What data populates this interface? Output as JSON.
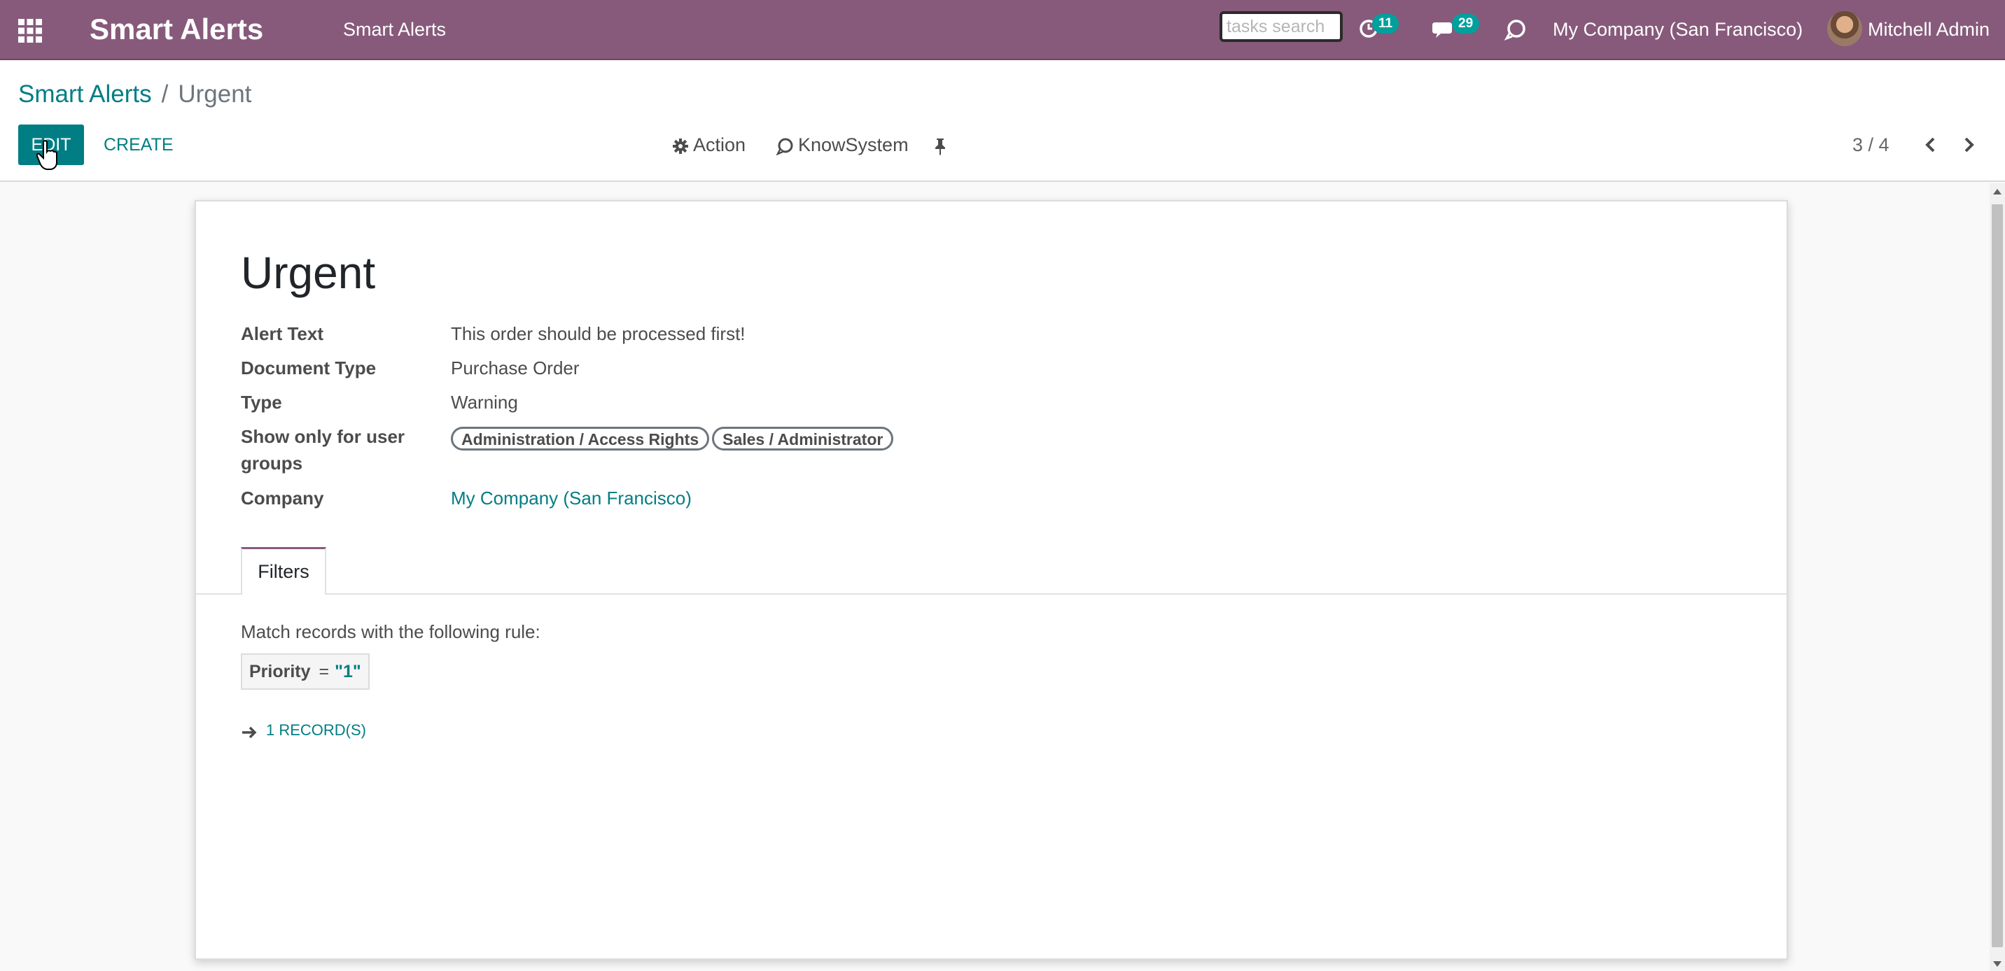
{
  "navbar": {
    "app_name": "Smart Alerts",
    "menu_item": "Smart Alerts",
    "search_placeholder": "tasks search",
    "activity_count": "11",
    "messages_count": "29",
    "company": "My Company (San Francisco)",
    "user_name": "Mitchell Admin",
    "icons": [
      "apps-grid-icon",
      "clock-icon",
      "chat-icon",
      "knowsystem-icon"
    ]
  },
  "control_panel": {
    "breadcrumb": [
      {
        "label": "Smart Alerts"
      },
      {
        "label": "Urgent"
      }
    ],
    "separator": "/",
    "edit_label": "EDIT",
    "create_label": "CREATE",
    "action_label": "Action",
    "knowsystem_label": "KnowSystem",
    "pager_value": "3 / 4"
  },
  "form": {
    "title": "Urgent",
    "fields": [
      {
        "label": "Alert Text",
        "value": "This order should be processed first!"
      },
      {
        "label": "Document Type",
        "value": "Purchase Order"
      },
      {
        "label": "Type",
        "value": "Warning"
      },
      {
        "label": "Show only for user groups",
        "tags": [
          "Administration / Access Rights",
          "Sales / Administrator"
        ]
      },
      {
        "label": "Company",
        "value": "My Company (San Francisco)"
      }
    ],
    "tabs": [
      {
        "label": "Filters",
        "active": true
      }
    ],
    "filters": {
      "rule_text": "Match records with the following rule:",
      "domain": {
        "field": "Priority",
        "operator": "=",
        "value": "\"1\""
      },
      "records_label": "1 RECORD(S)"
    }
  },
  "colors": {
    "brand": "#875a7b",
    "accent": "#017e84",
    "badge": "#00a09d"
  }
}
